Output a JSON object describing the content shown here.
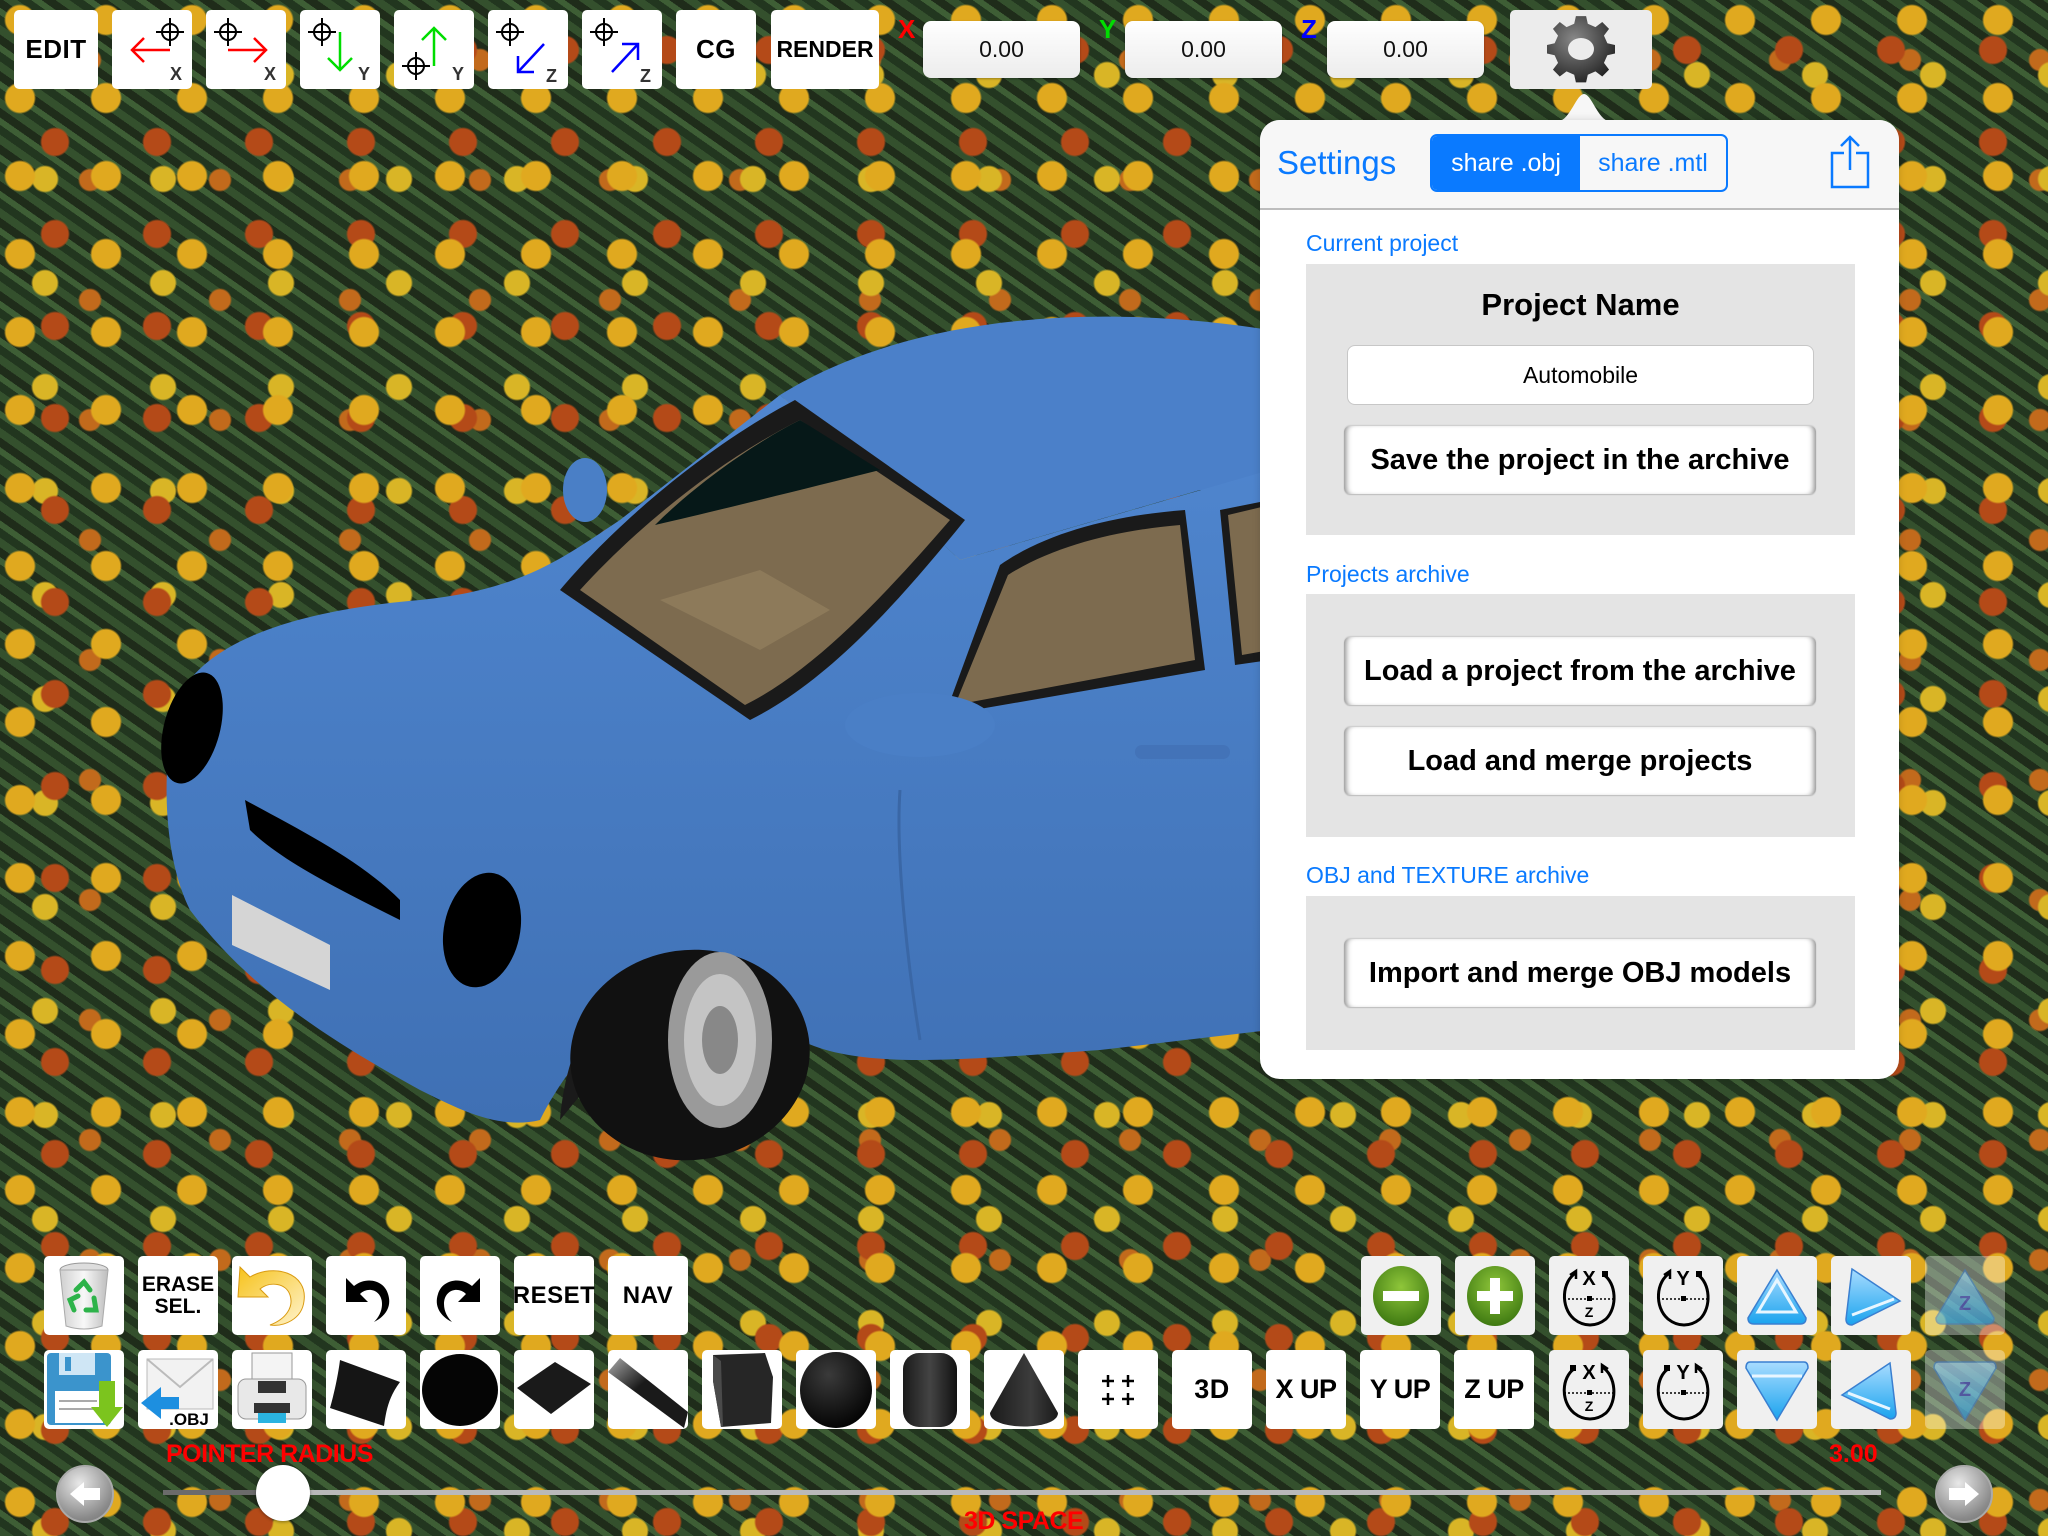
{
  "top_toolbar": {
    "edit_label": "EDIT",
    "move_buttons": [
      {
        "icon": "move-x-negative-icon",
        "axis": "X",
        "direction": "negative",
        "color": "#ff0000"
      },
      {
        "icon": "move-x-positive-icon",
        "axis": "X",
        "direction": "positive",
        "color": "#ff0000"
      },
      {
        "icon": "move-y-negative-icon",
        "axis": "Y",
        "direction": "negative",
        "color": "#00dd00"
      },
      {
        "icon": "move-y-positive-icon",
        "axis": "Y",
        "direction": "positive",
        "color": "#00dd00"
      },
      {
        "icon": "move-z-negative-icon",
        "axis": "Z",
        "direction": "negative",
        "color": "#0000ff"
      },
      {
        "icon": "move-z-positive-icon",
        "axis": "Z",
        "direction": "positive",
        "color": "#0000ff"
      }
    ],
    "cg_label": "CG",
    "render_label": "RENDER",
    "coords": {
      "x_label": "X",
      "x_value": "0.00",
      "x_color": "#ff0000",
      "y_label": "Y",
      "y_value": "0.00",
      "y_color": "#00dd00",
      "z_label": "Z",
      "z_value": "0.00",
      "z_color": "#0000ff"
    },
    "settings_icon": "gear-icon"
  },
  "popover": {
    "title": "Settings",
    "segments": [
      {
        "label": "share .obj",
        "active": true
      },
      {
        "label": "share .mtl",
        "active": false
      }
    ],
    "share_icon": "share-icon",
    "accent_color": "#0a7aff",
    "sections": {
      "current_project": {
        "label": "Current project",
        "project_name_heading": "Project Name",
        "project_name_value": "Automobile",
        "save_button": "Save the project in the archive"
      },
      "projects_archive": {
        "label": "Projects archive",
        "load_button": "Load a project from the archive",
        "merge_button": "Load and merge projects"
      },
      "obj_archive": {
        "label": "OBJ and TEXTURE archive",
        "import_button": "Import and merge OBJ models"
      }
    }
  },
  "bottom_toolbar": {
    "row1_left": [
      {
        "name": "recycle-bin-button",
        "icon": "recycle-bin-icon"
      },
      {
        "name": "erase-selection-button",
        "label": "ERASE\nSEL."
      },
      {
        "name": "revert-button",
        "icon": "yellow-undo-icon"
      },
      {
        "name": "undo-button",
        "icon": "undo-icon"
      },
      {
        "name": "redo-button",
        "icon": "redo-icon"
      },
      {
        "name": "reset-button",
        "label": "RESET"
      },
      {
        "name": "nav-button",
        "label": "NAV"
      }
    ],
    "row1_right": [
      {
        "name": "zoom-out-button",
        "icon": "minus-circle-icon"
      },
      {
        "name": "zoom-in-button",
        "icon": "plus-circle-icon"
      },
      {
        "name": "rotate-x-cw-button",
        "icon": "rotate-x-icon",
        "label": "X"
      },
      {
        "name": "rotate-y-cw-button",
        "icon": "rotate-y-icon",
        "label": "Y"
      },
      {
        "name": "move-up-button",
        "icon": "triangle-up-icon"
      },
      {
        "name": "move-right-button",
        "icon": "triangle-right-icon"
      },
      {
        "name": "move-z-up-button",
        "icon": "triangle-up-z-icon",
        "label": "Z",
        "disabled": true
      }
    ],
    "row2": [
      {
        "name": "save-button",
        "icon": "floppy-save-icon"
      },
      {
        "name": "import-obj-button",
        "icon": "mail-obj-icon",
        "label": ".OBJ"
      },
      {
        "name": "print-button",
        "icon": "printer-icon"
      },
      {
        "name": "add-plane-button",
        "icon": "plane-shape-icon"
      },
      {
        "name": "add-disc-button",
        "icon": "disc-shape-icon"
      },
      {
        "name": "add-square-button",
        "icon": "square-shape-icon"
      },
      {
        "name": "add-strip-button",
        "icon": "strip-shape-icon"
      },
      {
        "name": "add-cube-button",
        "icon": "cube-shape-icon"
      },
      {
        "name": "add-sphere-button",
        "icon": "sphere-shape-icon"
      },
      {
        "name": "add-cylinder-button",
        "icon": "cylinder-shape-icon"
      },
      {
        "name": "add-cone-button",
        "icon": "cone-shape-icon"
      },
      {
        "name": "add-points-button",
        "icon": "grid-points-icon"
      },
      {
        "name": "view-3d-button",
        "label": "3D"
      },
      {
        "name": "x-up-button",
        "label": "X UP"
      },
      {
        "name": "y-up-button",
        "label": "Y UP"
      },
      {
        "name": "z-up-button",
        "label": "Z UP"
      },
      {
        "name": "rotate-x-ccw-button",
        "icon": "rotate-x-icon",
        "label": "X"
      },
      {
        "name": "rotate-y-ccw-button",
        "icon": "rotate-y-icon",
        "label": "Y"
      },
      {
        "name": "move-down-button",
        "icon": "triangle-down-icon"
      },
      {
        "name": "move-left-button",
        "icon": "triangle-left-icon"
      },
      {
        "name": "move-z-down-button",
        "icon": "triangle-down-z-icon",
        "label": "Z",
        "disabled": true
      }
    ]
  },
  "slider": {
    "label": "POINTER RADIUS",
    "value_text": "3.00",
    "fraction": 0.07,
    "mode_label": "3D SPACE",
    "left_icon": "arrow-left-icon",
    "right_icon": "arrow-right-icon",
    "label_color": "#ff0000"
  },
  "scene": {
    "model_color": "#4a80c8",
    "background": "marigold flower texture"
  }
}
